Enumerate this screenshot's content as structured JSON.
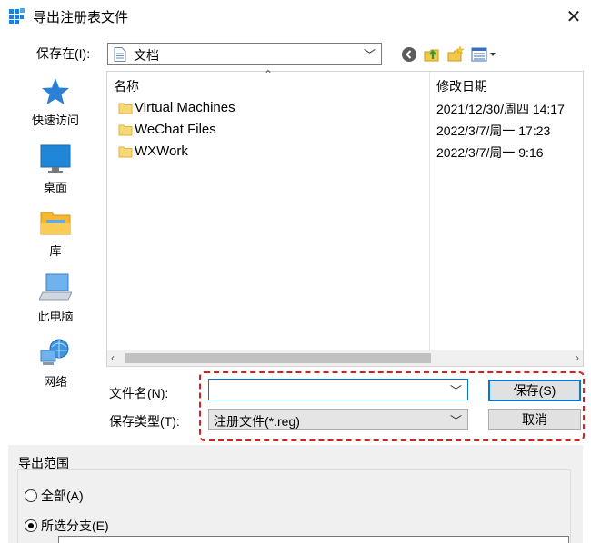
{
  "window": {
    "title": "导出注册表文件",
    "close_glyph": "✕"
  },
  "toolbar": {
    "save_in_label": "保存在(I):",
    "location": "文档",
    "icons": [
      "back-icon",
      "up-folder-icon",
      "new-folder-icon",
      "view-menu-icon"
    ]
  },
  "places": [
    {
      "label": "快速访问",
      "icon": "star-icon"
    },
    {
      "label": "桌面",
      "icon": "desktop-icon"
    },
    {
      "label": "库",
      "icon": "library-icon"
    },
    {
      "label": "此电脑",
      "icon": "computer-icon"
    },
    {
      "label": "网络",
      "icon": "network-icon"
    }
  ],
  "file_list": {
    "columns": {
      "name": "名称",
      "date": "修改日期",
      "sort_glyph": "⌃"
    },
    "rows": [
      {
        "name": "Virtual Machines",
        "date": "2021/12/30/周四 14:17"
      },
      {
        "name": "WeChat Files",
        "date": "2022/3/7/周一 17:23"
      },
      {
        "name": "WXWork",
        "date": "2022/3/7/周一 9:16"
      }
    ]
  },
  "form": {
    "filename_label": "文件名(N):",
    "filename_value": "",
    "filetype_label": "保存类型(T):",
    "filetype_value": "注册文件(*.reg)"
  },
  "buttons": {
    "save": "保存(S)",
    "cancel": "取消"
  },
  "export_range": {
    "title": "导出范围",
    "options": [
      {
        "label": "全部(A)",
        "checked": false
      },
      {
        "label": "所选分支(E)",
        "checked": true
      }
    ]
  },
  "colors": {
    "accent": "#0078d7",
    "highlight": "#d62020",
    "folder": "#f8d775"
  }
}
